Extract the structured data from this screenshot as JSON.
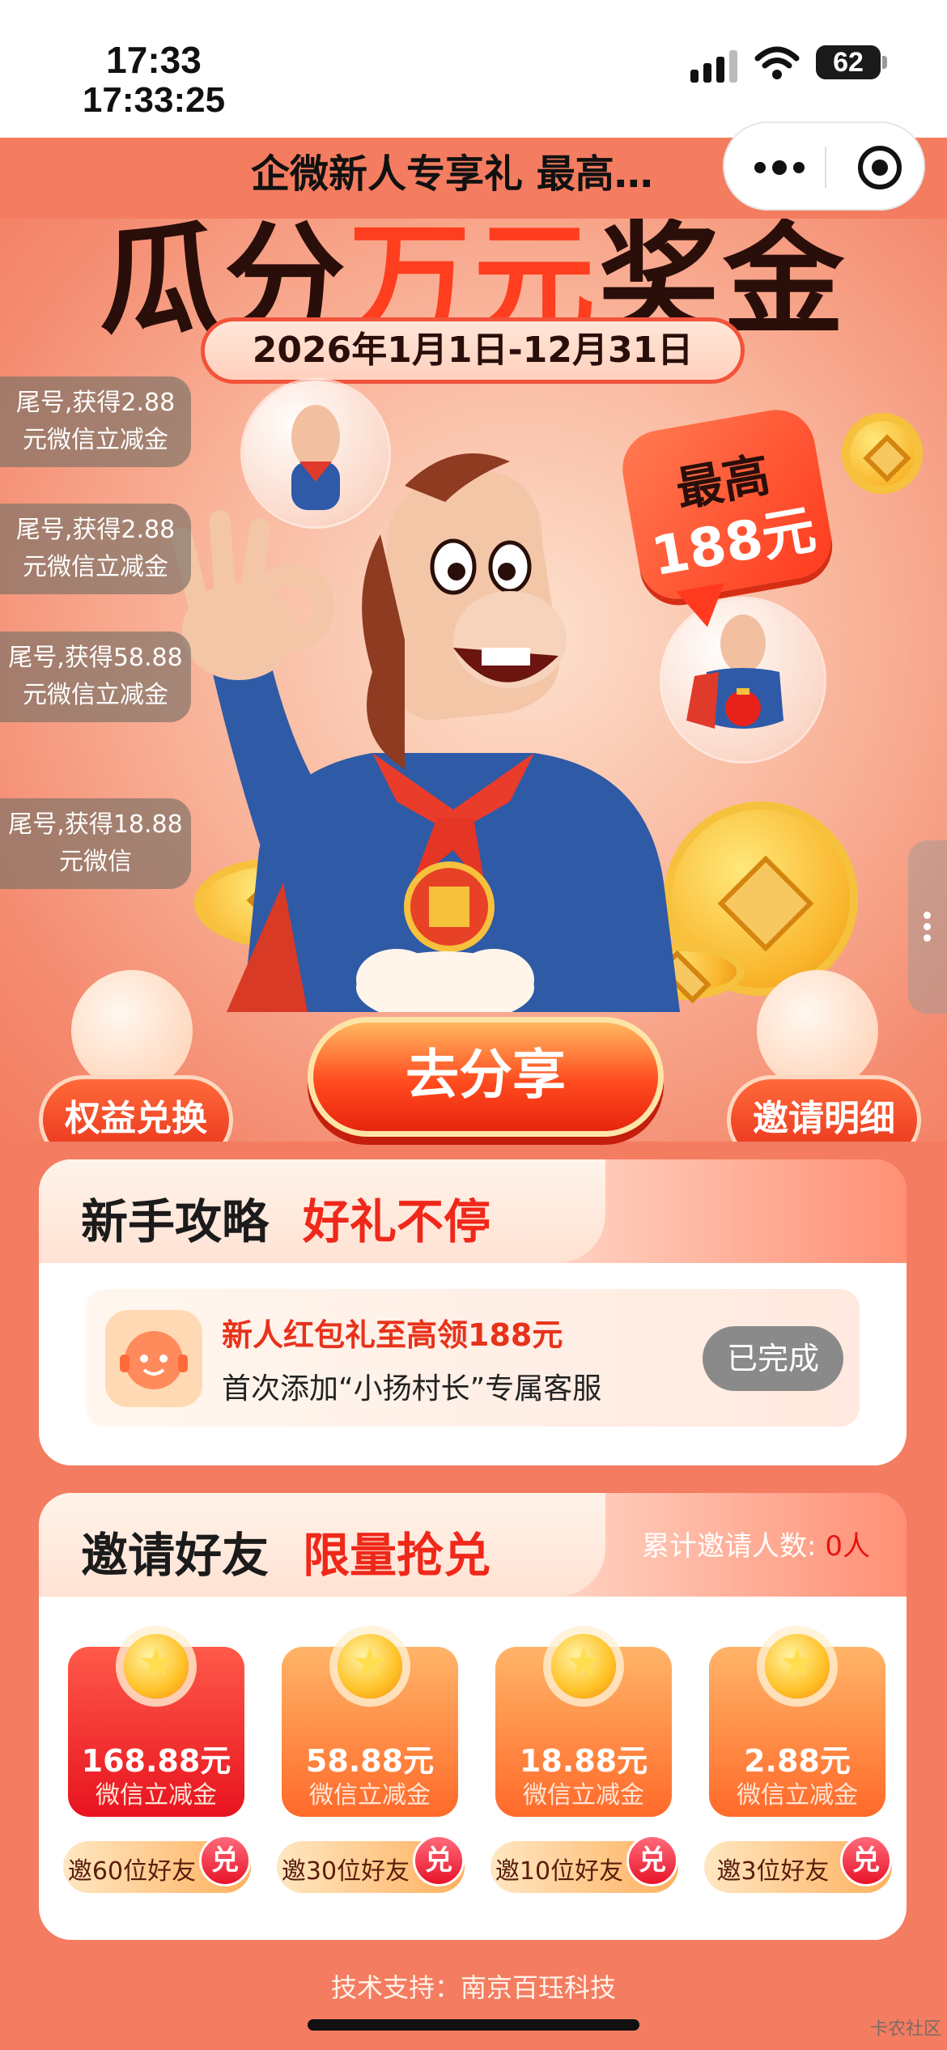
{
  "status_bar": {
    "time": "17:33",
    "clock": "17:33:25",
    "battery": "62",
    "signal_icon": "signal-icon",
    "wifi_icon": "wifi-icon"
  },
  "nav": {
    "title": "企微新人专享礼 最高…",
    "more_icon": "more-dots-icon",
    "close_icon": "target-close-icon"
  },
  "hero": {
    "title_a": "瓜分",
    "title_hl": "万元",
    "title_b": "奖金",
    "date_range": "2026年1月1日-12月31日",
    "max_label": "最高",
    "max_value": "188元",
    "share_button": "去分享",
    "left_button": "权益兑换",
    "right_button": "邀请明细"
  },
  "toasts": [
    {
      "text": "尾号,获得2.88元微信立减金"
    },
    {
      "text": "尾号,获得2.88元微信立减金"
    },
    {
      "text": "尾号,获得58.88元微信立减金"
    },
    {
      "text": "尾号,获得18.88元微信"
    }
  ],
  "guide": {
    "title_a": "新手攻略",
    "title_b": "好礼不停",
    "task_title": "新人红包礼至高领188元",
    "task_desc": "首次添加“小扬村长”专属客服",
    "task_status": "已完成"
  },
  "invite": {
    "title_a": "邀请好友",
    "title_b": "限量抢兑",
    "count_label": "累计邀请人数:",
    "count_value": "0人",
    "rewards": [
      {
        "amount": "168.88元",
        "label": "微信立减金",
        "requirement": "邀60位好友",
        "button": "兑"
      },
      {
        "amount": "58.88元",
        "label": "微信立减金",
        "requirement": "邀30位好友",
        "button": "兑"
      },
      {
        "amount": "18.88元",
        "label": "微信立减金",
        "requirement": "邀10位好友",
        "button": "兑"
      },
      {
        "amount": "2.88元",
        "label": "微信立减金",
        "requirement": "邀3位好友",
        "button": "兑"
      }
    ]
  },
  "footer": {
    "tech_support": "技术支持：南京百珏科技",
    "watermark": "卡农社区"
  },
  "colors": {
    "brand_red": "#f0281a",
    "page_bg": "#f47c60",
    "done_gray": "#8a8a8a"
  }
}
